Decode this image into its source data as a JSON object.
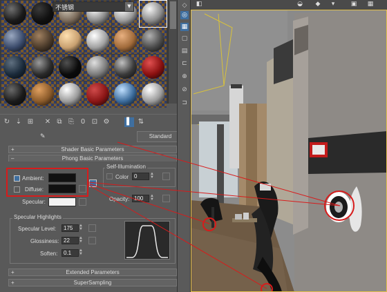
{
  "material_editor": {
    "slots": [
      {
        "base": "#1a1a1a",
        "light": "#707070"
      },
      {
        "base": "#101010",
        "light": "#3a3a3a"
      },
      {
        "base": "#7a6a5a",
        "light": "#d0c8b8"
      },
      {
        "base": "#8a8a8a",
        "light": "#ffffff"
      },
      {
        "base": "#9a9a9a",
        "light": "#ffffff"
      },
      {
        "base": "#8a8a8a",
        "light": "#f5f5f5"
      },
      {
        "base": "#3a4a6a",
        "light": "#9aa8c0"
      },
      {
        "base": "#4a3a2a",
        "light": "#a08060"
      },
      {
        "base": "#c8a070",
        "light": "#ffe0b0"
      },
      {
        "base": "#a0a0a0",
        "light": "#ffffff"
      },
      {
        "base": "#a06a3a",
        "light": "#e8b080"
      },
      {
        "base": "#4a4a4a",
        "light": "#b0b0b0"
      },
      {
        "base": "#1a2a3a",
        "light": "#607080"
      },
      {
        "base": "#2a2a2a",
        "light": "#9a9a9a"
      },
      {
        "base": "#0a0a0a",
        "light": "#505050"
      },
      {
        "base": "#7a7a7a",
        "light": "#e0e0e0"
      },
      {
        "base": "#3a3a3a",
        "light": "#c0c0c0"
      },
      {
        "base": "#8a1010",
        "light": "#e05050"
      },
      {
        "base": "#1a1a1a",
        "light": "#6a6a6a"
      },
      {
        "base": "#8a5a2a",
        "light": "#e0a060"
      },
      {
        "base": "#9a9a9a",
        "light": "#ffffff"
      },
      {
        "base": "#8a1515",
        "light": "#d04a4a"
      },
      {
        "base": "#3a6a9a",
        "light": "#c0e0ff"
      },
      {
        "base": "#9a9a9a",
        "light": "#ffffff"
      }
    ],
    "material_name": "不锈钢",
    "material_type": "Standard",
    "rollouts": {
      "shader_basic": "Shader Basic Parameters",
      "phong_basic": "Phong Basic Parameters",
      "extended": "Extended Parameters",
      "supersampling": "SuperSampling"
    },
    "phong": {
      "ambient_label": "Ambient:",
      "diffuse_label": "Diffuse:",
      "specular_label": "Specular:",
      "ambient_color": "#111111",
      "diffuse_color": "#111111",
      "specular_color": "#f2f2f2",
      "self_illum_title": "Self-Illumination",
      "color_label": "Color",
      "self_illum_value": "0",
      "opacity_label": "Opacity:",
      "opacity_value": "100",
      "spec_highlights_title": "Specular Highlights",
      "spec_level_label": "Specular Level:",
      "spec_level_value": "175",
      "glossiness_label": "Glossiness:",
      "glossiness_value": "22",
      "soften_label": "Soften:",
      "soften_value": "0.1"
    },
    "toolbar_icons": [
      "get-material-icon",
      "put-to-scene-icon",
      "assign-material-icon",
      "delete-icon",
      "make-unique-icon",
      "put-to-library-icon",
      "material-effects-channel-icon",
      "show-map-icon",
      "show-end-result-icon",
      "go-to-parent-icon",
      "go-forward-icon"
    ]
  },
  "highlight_color": "#d81b1b"
}
